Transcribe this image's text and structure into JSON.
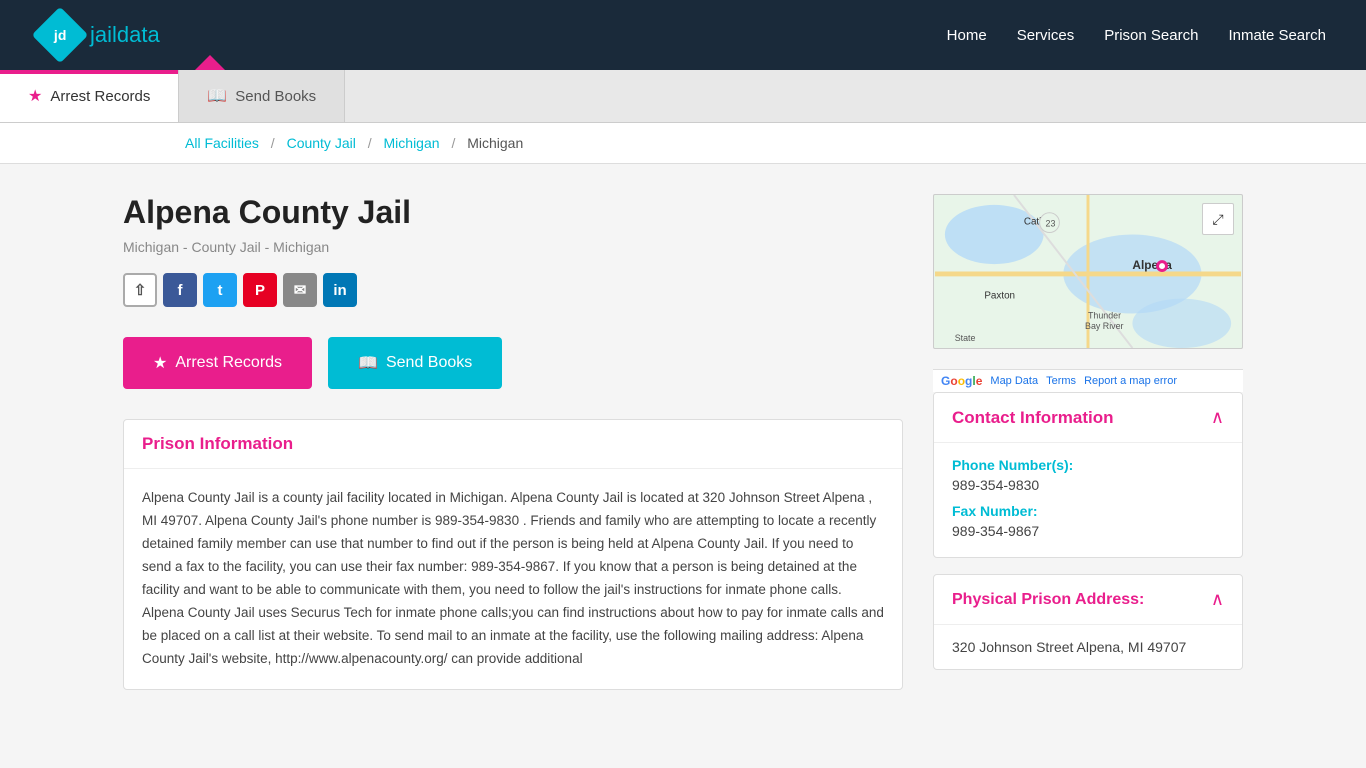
{
  "navbar": {
    "logo_jd": "jd",
    "logo_jail": "jail",
    "logo_data": "data",
    "links": [
      {
        "id": "home",
        "label": "Home",
        "href": "#"
      },
      {
        "id": "services",
        "label": "Services",
        "href": "#"
      },
      {
        "id": "prison-search",
        "label": "Prison Search",
        "href": "#"
      },
      {
        "id": "inmate-search",
        "label": "Inmate Search",
        "href": "#"
      }
    ]
  },
  "tabs": [
    {
      "id": "arrest-records",
      "label": "Arrest Records",
      "active": true,
      "icon": "star"
    },
    {
      "id": "send-books",
      "label": "Send Books",
      "active": false,
      "icon": "book"
    }
  ],
  "breadcrumb": {
    "all_facilities": "All Facilities",
    "county_jail": "County Jail",
    "state": "Michigan",
    "current": "Michigan"
  },
  "facility": {
    "title": "Alpena County Jail",
    "subtitle": "Michigan - County Jail - Michigan"
  },
  "social": [
    {
      "id": "share",
      "label": "⇧",
      "class": "share"
    },
    {
      "id": "facebook",
      "label": "f",
      "class": "facebook"
    },
    {
      "id": "twitter",
      "label": "t",
      "class": "twitter"
    },
    {
      "id": "pinterest",
      "label": "P",
      "class": "pinterest"
    },
    {
      "id": "email",
      "label": "✉",
      "class": "email"
    },
    {
      "id": "linkedin",
      "label": "in",
      "class": "linkedin"
    }
  ],
  "buttons": {
    "arrest_records": "Arrest Records",
    "send_books": "Send Books"
  },
  "prison_info": {
    "section_title": "Prison Information",
    "body": "Alpena County Jail is a county jail facility located in Michigan. Alpena County Jail is located at 320 Johnson Street Alpena , MI 49707. Alpena County Jail's phone number is 989-354-9830 . Friends and family who are attempting to locate a recently detained family member can use that number to find out if the person is being held at Alpena County Jail. If you need to send a fax to the facility, you can use their fax number: 989-354-9867. If you know that a person is being detained at the facility and want to be able to communicate with them, you need to follow the jail's instructions for inmate phone calls. Alpena County Jail uses Securus Tech for inmate phone calls;you can find instructions about how to pay for inmate calls and be placed on a call list at their website. To send mail to an inmate at the facility, use the following mailing address:  Alpena County Jail's website, http://www.alpenacounty.org/ can provide additional"
  },
  "map": {
    "expand_label": "⤢",
    "footer": {
      "map_data": "Map Data",
      "terms": "Terms",
      "report": "Report a map error"
    }
  },
  "contact_info": {
    "section_title": "Contact Information",
    "phone_label": "Phone Number(s):",
    "phone_value": "989-354-9830",
    "fax_label": "Fax Number:",
    "fax_value": "989-354-9867"
  },
  "address_info": {
    "section_title": "Physical Prison Address:",
    "address": "320 Johnson Street Alpena, MI 49707"
  }
}
